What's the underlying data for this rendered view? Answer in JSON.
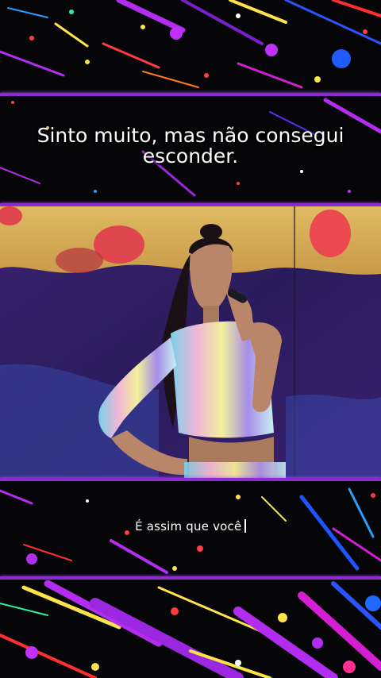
{
  "captions": {
    "top_line1": "Sinto muito, mas não consegui",
    "top_line2": "esconder.",
    "bottom": "É assim que você"
  },
  "colors": {
    "divider": "#8b2cd0",
    "background": "#060508",
    "stage_wall": "#d9b25c",
    "stage_purple": "#35205e"
  },
  "icons": {
    "cursor": "text-cursor"
  }
}
